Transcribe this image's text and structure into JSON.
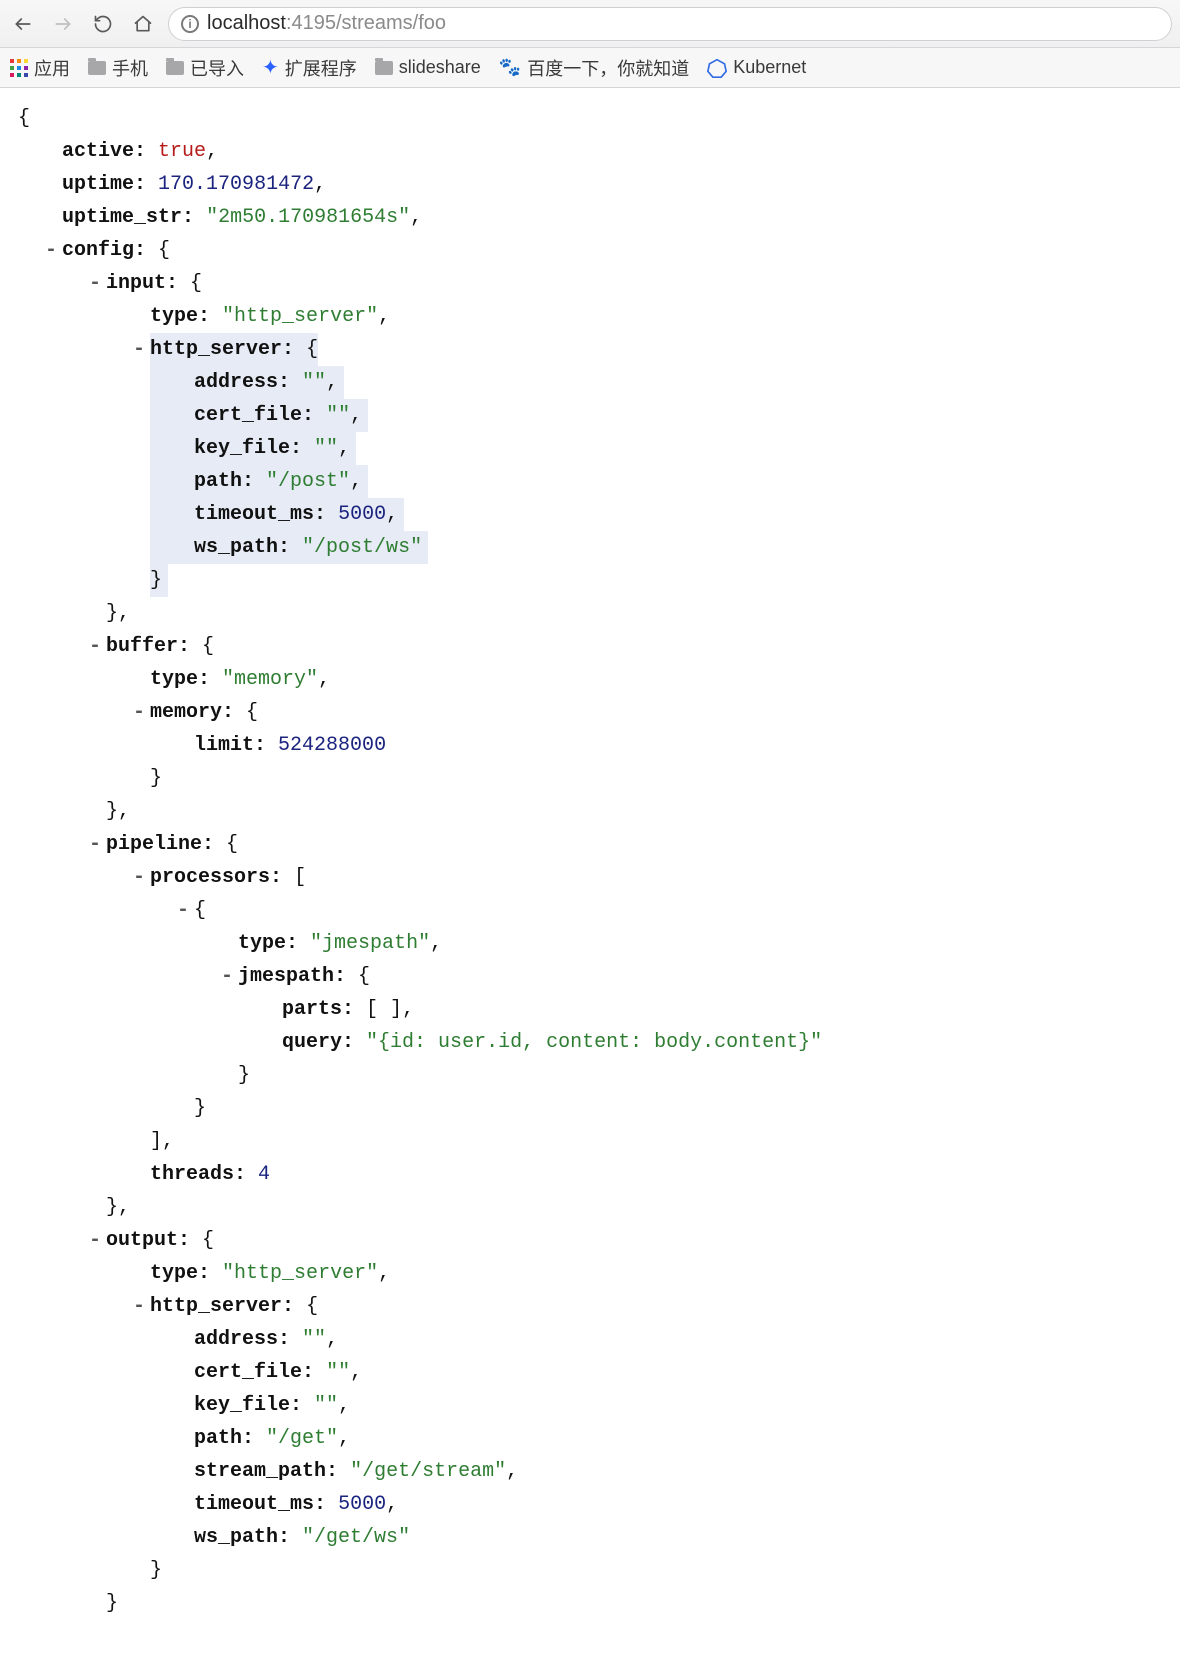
{
  "browser": {
    "url_host": "localhost",
    "url_port": ":4195",
    "url_path": "/streams/foo"
  },
  "bookmarks": {
    "apps": "应用",
    "mobile": "手机",
    "imported": "已导入",
    "extensions": "扩展程序",
    "slideshare": "slideshare",
    "baidu": "百度一下，你就知道",
    "kubernetes": "Kubernet"
  },
  "json": {
    "active_key": "active",
    "active_val": "true",
    "uptime_key": "uptime",
    "uptime_val": "170.170981472",
    "uptime_str_key": "uptime_str",
    "uptime_str_val": "\"2m50.170981654s\"",
    "config_key": "config",
    "input_key": "input",
    "type_key": "type",
    "input_type_val": "\"http_server\"",
    "http_server_key": "http_server",
    "address_key": "address",
    "empty_str": "\"\"",
    "cert_file_key": "cert_file",
    "key_file_key": "key_file",
    "path_key": "path",
    "input_path_val": "\"/post\"",
    "timeout_key": "timeout_ms",
    "timeout_val": "5000",
    "ws_path_key": "ws_path",
    "input_ws_val": "\"/post/ws\"",
    "buffer_key": "buffer",
    "buffer_type_val": "\"memory\"",
    "memory_key": "memory",
    "limit_key": "limit",
    "limit_val": "524288000",
    "pipeline_key": "pipeline",
    "processors_key": "processors",
    "proc_type_val": "\"jmespath\"",
    "jmespath_key": "jmespath",
    "parts_key": "parts",
    "parts_val": "[ ]",
    "query_key": "query",
    "query_val": "\"{id: user.id, content: body.content}\"",
    "threads_key": "threads",
    "threads_val": "4",
    "output_key": "output",
    "output_type_val": "\"http_server\"",
    "output_path_val": "\"/get\"",
    "stream_path_key": "stream_path",
    "stream_path_val": "\"/get/stream\"",
    "output_ws_val": "\"/get/ws\""
  }
}
